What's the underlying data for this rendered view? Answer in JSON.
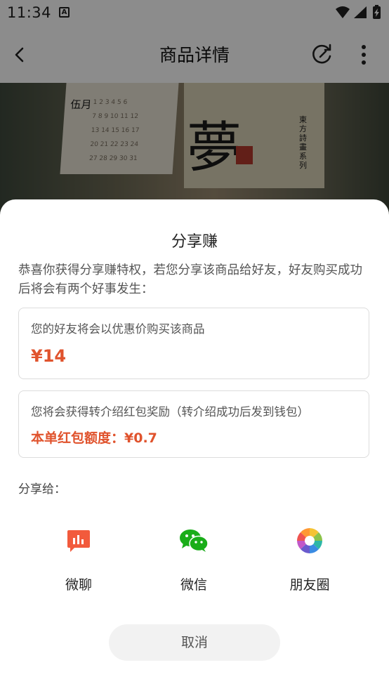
{
  "status_bar": {
    "time": "11:34",
    "a_icon": "A"
  },
  "header": {
    "title": "商品详情"
  },
  "product_image": {
    "calendar_month": "伍月",
    "calendar_calligraphy": "夢",
    "calendar_series": "東方詩畫系列"
  },
  "share_sheet": {
    "title": "分享赚",
    "description": "恭喜你获得分享赚特权，若您分享该商品给好友，好友购买成功后将会有两个好事发生：",
    "card_friend": {
      "label": "您的好友将会以优惠价购买该商品",
      "price": "¥14"
    },
    "card_reward": {
      "label": "您将会获得转介绍红包奖励（转介绍成功后发到钱包）",
      "amount": "本单红包额度：¥0.7"
    },
    "share_to_label": "分享给：",
    "targets": [
      {
        "label": "微聊",
        "icon": "weiliao-chart-icon",
        "color": "#f25a3c"
      },
      {
        "label": "微信",
        "icon": "wechat-icon",
        "color": "#1aad19"
      },
      {
        "label": "朋友圈",
        "icon": "moments-aperture-icon"
      }
    ],
    "cancel_label": "取消"
  },
  "colors": {
    "accent": "#e0532d",
    "wechat": "#1aad19",
    "weiliao": "#f25a3c"
  }
}
